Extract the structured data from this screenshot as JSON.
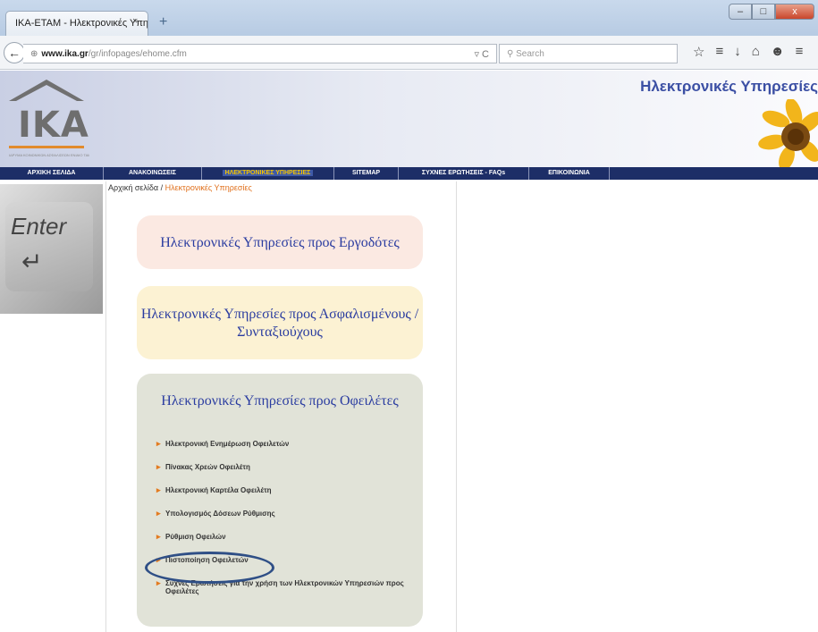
{
  "browser": {
    "tab_title": "IKA-ETAM - Ηλεκτρονικές Υπη...",
    "tab_close": "×",
    "new_tab": "+",
    "window_controls": [
      "–",
      "□",
      "x"
    ],
    "back": "←",
    "url_host": "www.ika.gr",
    "url_path": "/gr/infopages/ehome.cfm",
    "url_reload": "▿ C",
    "search_placeholder": "Search",
    "toolbar_icons": [
      "☆",
      "≡",
      "↓",
      "⌂",
      "☻",
      "≡"
    ]
  },
  "header": {
    "logo_text": "IKA",
    "logo_subtitle": "ΙΔΡΥΜΑ ΚΟΙΝΩΝΙΚΩΝ ΑΣΦΑΛΙΣΕΩΝ ΕΝΙΑΙΟ ΤΑΜΕΙΟ ΑΣΦΑΛΙΣΗΣ ΜΙΣΘΩΤΩΝ",
    "site_title": "Ηλεκτρονικές Υπηρεσίες"
  },
  "menu": [
    "ΑΡΧΙΚΗ ΣΕΛΙΔΑ",
    "ΑΝΑΚΟΙΝΩΣΕΙΣ",
    "ΗΛΕΚΤΡΟΝΙΚΕΣ ΥΠΗΡΕΣΙΕΣ",
    "SITEMAP",
    "ΣΥΧΝΕΣ ΕΡΩΤΗΣΕΙΣ - FAQs",
    "ΕΠΙΚΟΙΝΩΝΙΑ",
    ""
  ],
  "left_image": {
    "label": "Enter",
    "arrow": "↵"
  },
  "breadcrumb": {
    "home": "Αρχική σελίδα",
    "separator": " / ",
    "current": "Ηλεκτρονικές Υπηρεσίες"
  },
  "boxes": {
    "employers": "Ηλεκτρονικές Υπηρεσίες προς Εργοδότες",
    "insured": "Ηλεκτρονικές Υπηρεσίες προς Ασφαλισμένους / Συνταξιούχους",
    "debtors": "Ηλεκτρονικές Υπηρεσίες προς Οφειλέτες"
  },
  "debtor_links": [
    "Ηλεκτρονική Ενημέρωση Οφειλετών",
    "Πίνακας Χρεών Οφειλέτη",
    "Ηλεκτρονική Καρτέλα Οφειλέτη",
    "Υπολογισμός Δόσεων Ρύθμισης",
    "Ρύθμιση Οφειλών",
    "Πιστοποίηση Οφειλετών",
    "Συχνές Ερωτήσεις για την χρήση των Ηλεκτρονικών Υπηρεσιών προς Οφειλέτες"
  ],
  "colors": {
    "menu_bg": "#1d2e67",
    "link_blue": "#2a3ca0",
    "accent_orange": "#e0701c",
    "oval": "#2f4f86"
  }
}
